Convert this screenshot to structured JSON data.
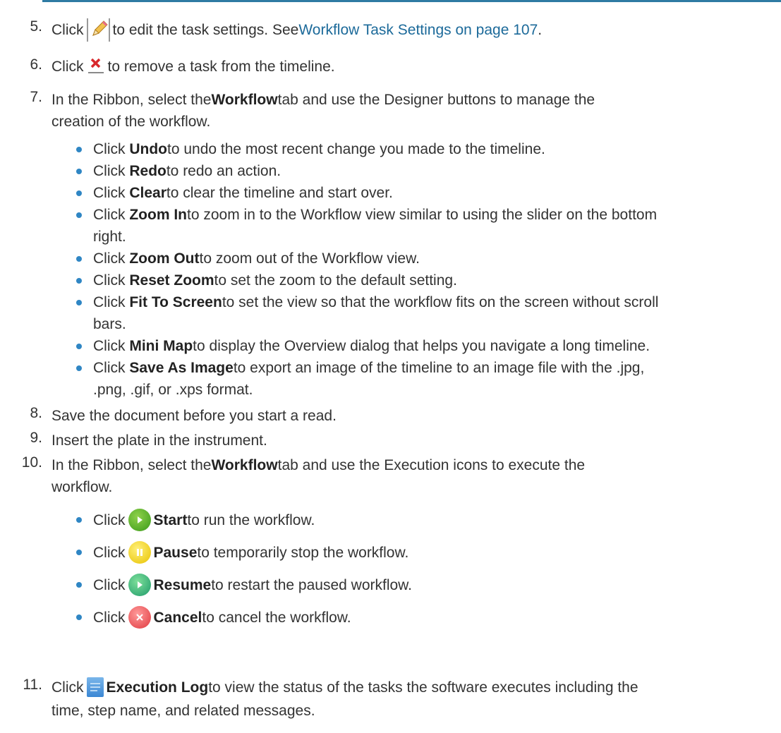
{
  "steps": {
    "s5": {
      "num": "5.",
      "pre": "Click",
      "post": "to edit the task settings. See ",
      "link": "Workflow Task Settings on page 107",
      "end": "."
    },
    "s6": {
      "num": "6.",
      "pre": "Click",
      "post": "to remove a task from the timeline."
    },
    "s7": {
      "num": "7.",
      "a": "In the Ribbon, select the ",
      "b": "Workflow",
      "c": " tab and use the Designer buttons to manage the",
      "d": "creation of the workflow."
    },
    "s8": {
      "num": "8.",
      "text": "Save the document before you start a read."
    },
    "s9": {
      "num": "9.",
      "text": "Insert the plate in the instrument."
    },
    "s10": {
      "num": "10.",
      "a": "In the Ribbon, select the ",
      "b": "Workflow",
      "c": " tab and use the Execution icons to execute the",
      "d": "workflow."
    },
    "s11": {
      "num": "11.",
      "pre": "Click",
      "bold": "Execution Log",
      "post": " to view the status of the tasks the software executes including the",
      "line2": "time, step name, and related messages."
    }
  },
  "designer_bullets": [
    {
      "pre": "Click ",
      "bold": "Undo",
      "post": " to undo the most recent change you made to the timeline.",
      "line2": ""
    },
    {
      "pre": "Click ",
      "bold": "Redo",
      "post": " to redo an action.",
      "line2": ""
    },
    {
      "pre": "Click ",
      "bold": "Clear",
      "post": " to clear the timeline and start over.",
      "line2": ""
    },
    {
      "pre": "Click ",
      "bold": "Zoom In",
      "post": " to zoom in to the Workflow view similar to using the slider on the bottom",
      "line2": "right."
    },
    {
      "pre": "Click ",
      "bold": "Zoom Out",
      "post": " to zoom out of the Workflow view.",
      "line2": ""
    },
    {
      "pre": "Click ",
      "bold": "Reset Zoom",
      "post": " to set the zoom to the default setting.",
      "line2": ""
    },
    {
      "pre": "Click ",
      "bold": "Fit To Screen",
      "post": " to set the view so that the workflow fits on the screen without scroll",
      "line2": "bars."
    },
    {
      "pre": "Click ",
      "bold": "Mini Map",
      "post": " to display the Overview dialog that helps you navigate a long timeline.",
      "line2": ""
    },
    {
      "pre": "Click ",
      "bold": "Save As Image",
      "post": " to export an image of the timeline to an image file with the .jpg,",
      "line2": ".png, .gif, or .xps format."
    }
  ],
  "execution_bullets": [
    {
      "pre": "Click",
      "bold": "Start",
      "post": " to run the workflow.",
      "icon": "start-icon"
    },
    {
      "pre": "Click",
      "bold": "Pause",
      "post": " to temporarily stop the workflow.",
      "icon": "pause-icon"
    },
    {
      "pre": "Click",
      "bold": "Resume",
      "post": " to restart the paused workflow.",
      "icon": "resume-icon"
    },
    {
      "pre": "Click",
      "bold": "Cancel",
      "post": " to cancel the workflow.",
      "icon": "cancel-icon"
    }
  ],
  "colors": {
    "link": "#1c6a9a",
    "rule": "#2f7ba3",
    "bullet": "#2f86c4"
  }
}
